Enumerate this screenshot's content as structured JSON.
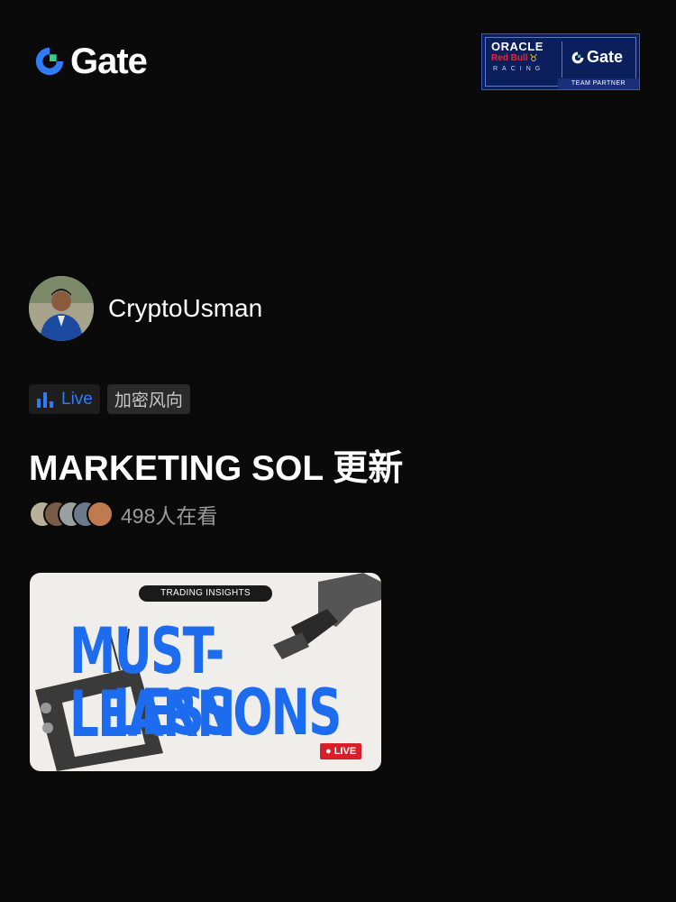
{
  "brand": {
    "logo_text": "Gate"
  },
  "partner_badge": {
    "oracle": "ORACLE",
    "redbull": "Red Bull",
    "racing": "RACING",
    "gate": "Gate",
    "team_partner": "TEAM PARTNER"
  },
  "author": {
    "name": "CryptoUsman"
  },
  "tags": {
    "live": "Live",
    "category": "加密风向"
  },
  "stream": {
    "title": "MARKETING SOL 更新",
    "viewers": "498人在看"
  },
  "cover": {
    "pill": "TRADING INSIGHTS",
    "line1": "MUST-LEARN",
    "line2": "LESSONS",
    "live_badge": "● LIVE"
  },
  "colors": {
    "accent": "#2f7cf6",
    "cover_text": "#1d6cf0",
    "live_red": "#d81e28"
  }
}
